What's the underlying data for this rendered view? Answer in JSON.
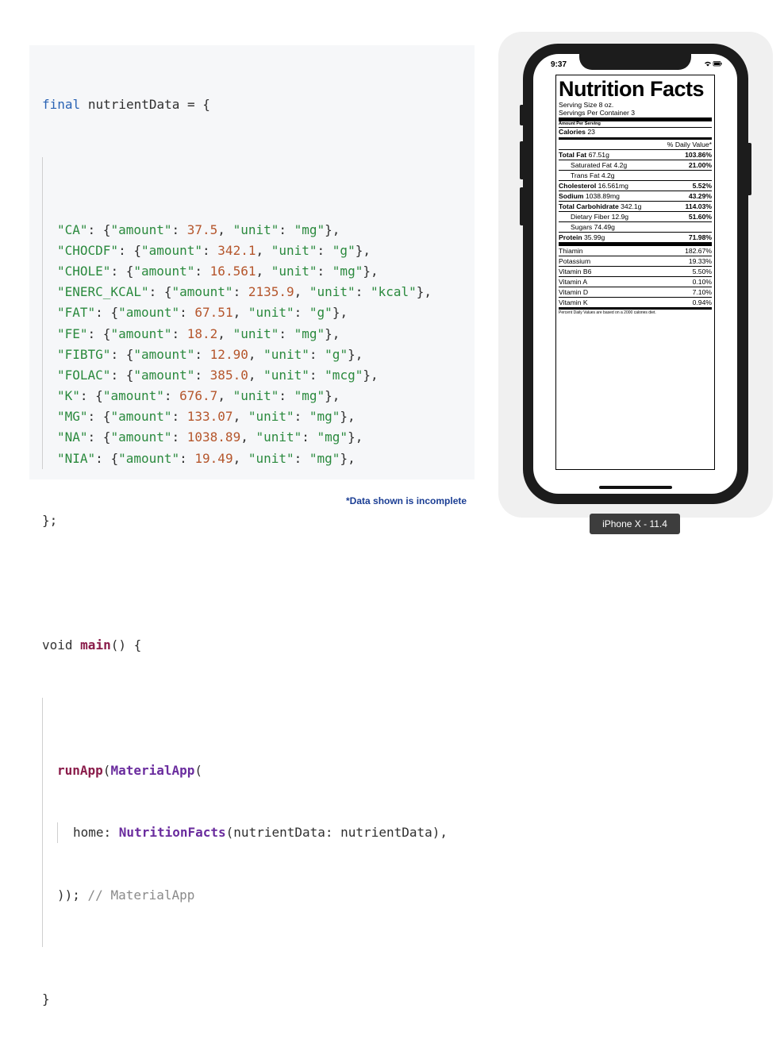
{
  "code": {
    "var_decl_keyword": "final",
    "var_decl_name": "nutrientData",
    "entries": [
      {
        "key": "\"CA\"",
        "amount": "37.5",
        "unit": "\"mg\""
      },
      {
        "key": "\"CHOCDF\"",
        "amount": "342.1",
        "unit": "\"g\""
      },
      {
        "key": "\"CHOLE\"",
        "amount": "16.561",
        "unit": "\"mg\""
      },
      {
        "key": "\"ENERC_KCAL\"",
        "amount": "2135.9",
        "unit": "\"kcal\""
      },
      {
        "key": "\"FAT\"",
        "amount": "67.51",
        "unit": "\"g\""
      },
      {
        "key": "\"FE\"",
        "amount": "18.2",
        "unit": "\"mg\""
      },
      {
        "key": "\"FIBTG\"",
        "amount": "12.90",
        "unit": "\"g\""
      },
      {
        "key": "\"FOLAC\"",
        "amount": "385.0",
        "unit": "\"mcg\""
      },
      {
        "key": "\"K\"",
        "amount": "676.7",
        "unit": "\"mg\""
      },
      {
        "key": "\"MG\"",
        "amount": "133.07",
        "unit": "\"mg\""
      },
      {
        "key": "\"NA\"",
        "amount": "1038.89",
        "unit": "\"mg\""
      },
      {
        "key": "\"NIA\"",
        "amount": "19.49",
        "unit": "\"mg\""
      }
    ],
    "amount_key": "\"amount\"",
    "unit_key": "\"unit\"",
    "close_map": "};",
    "main_keyword": "void",
    "main_name": "main",
    "run_app": "runApp",
    "material_app": "MaterialApp",
    "home_label": "home",
    "nutrition_facts": "NutritionFacts",
    "home_arg": "nutrientData: nutrientData",
    "close_call": "));",
    "close_comment": "// MaterialApp",
    "close_main": "}"
  },
  "note": "*Data shown is incomplete",
  "phone": {
    "time": "9:37",
    "device_label": "iPhone X - 11.4"
  },
  "label": {
    "title": "Nutrition Facts",
    "serving_size": "Serving Size 8 oz.",
    "servings_per_container": "Servings Per Container 3",
    "amount_per_serving": "Amount Per Serving",
    "calories_label": "Calories",
    "calories_value": "23",
    "daily_value_header": "% Daily Value*",
    "rows": [
      {
        "name": "Total Fat",
        "amount": "67.51g",
        "pct": "103.86%",
        "bold": true,
        "sub": false
      },
      {
        "name": "Saturated Fat",
        "amount": "4.2g",
        "pct": "21.00%",
        "bold": false,
        "sub": true
      },
      {
        "name": "Trans Fat",
        "amount": "4.2g",
        "pct": "",
        "bold": false,
        "sub": true
      },
      {
        "name": "Cholesterol",
        "amount": "16.561mg",
        "pct": "5.52%",
        "bold": true,
        "sub": false
      },
      {
        "name": "Sodium",
        "amount": "1038.89mg",
        "pct": "43.29%",
        "bold": true,
        "sub": false
      },
      {
        "name": "Total Carbohidrate",
        "amount": "342.1g",
        "pct": "114.03%",
        "bold": true,
        "sub": false
      },
      {
        "name": "Dietary Fiber",
        "amount": "12.9g",
        "pct": "51.60%",
        "bold": false,
        "sub": true
      },
      {
        "name": "Sugars",
        "amount": "74.49g",
        "pct": "",
        "bold": false,
        "sub": true
      },
      {
        "name": "Protein",
        "amount": "35.99g",
        "pct": "71.98%",
        "bold": true,
        "sub": false
      }
    ],
    "vitamins": [
      {
        "name": "Thiamin",
        "pct": "182.67%"
      },
      {
        "name": "Potassium",
        "pct": "19.33%"
      },
      {
        "name": "Vitamin B6",
        "pct": "5.50%"
      },
      {
        "name": "Vitamin A",
        "pct": "0.10%"
      },
      {
        "name": "Vitamin D",
        "pct": "7.10%"
      },
      {
        "name": "Vitamin K",
        "pct": "0.94%"
      }
    ],
    "footnote": "Percent Daily Values are based on a 2000 calories diet."
  }
}
